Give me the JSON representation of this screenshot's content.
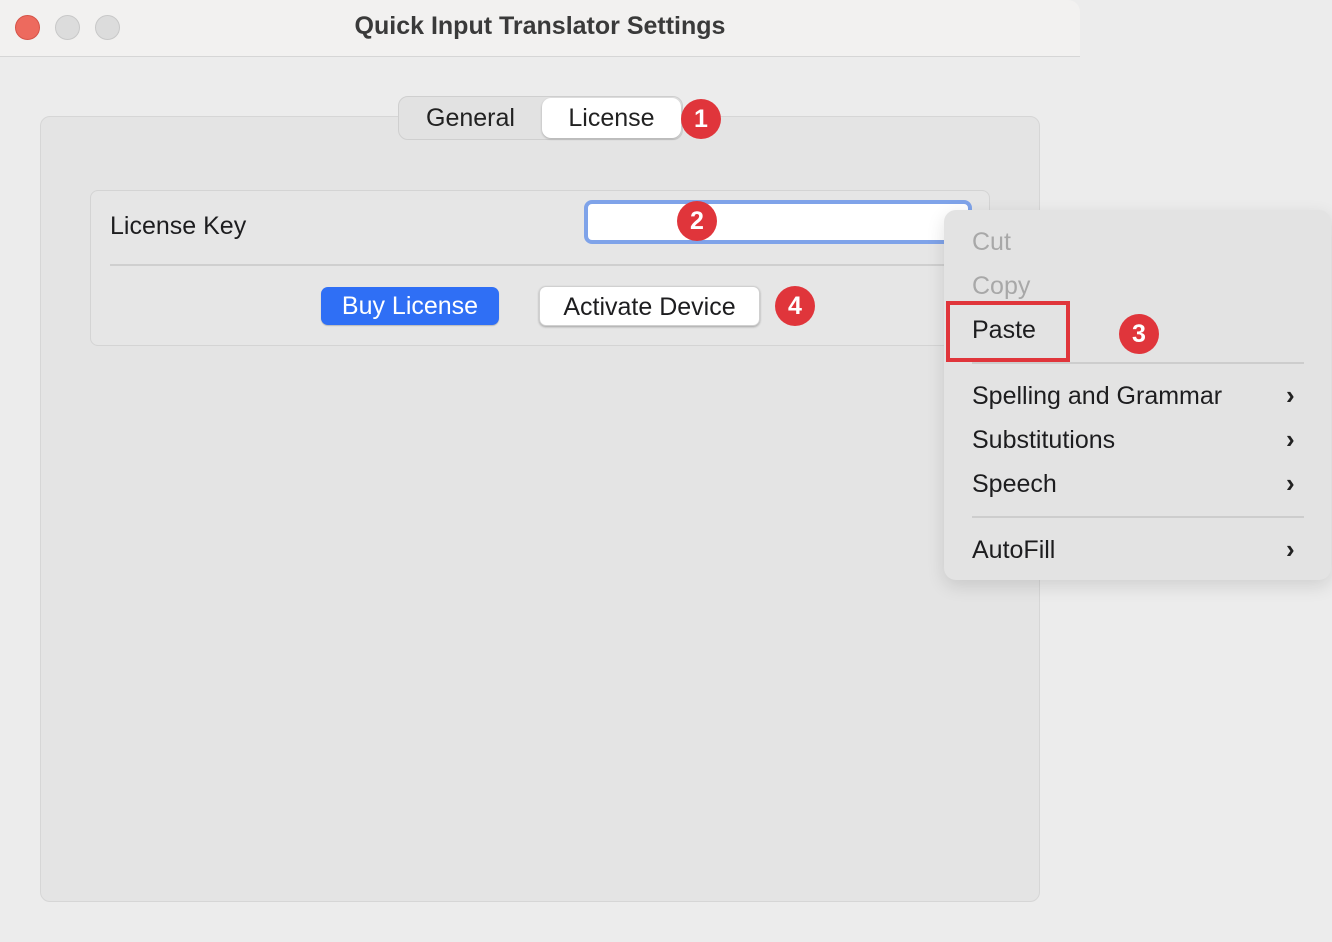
{
  "window": {
    "title": "Quick Input Translator Settings"
  },
  "tabs": [
    {
      "label": "General"
    },
    {
      "label": "License"
    }
  ],
  "license": {
    "key_label": "License Key",
    "key_value": "",
    "buy_label": "Buy License",
    "activate_label": "Activate Device"
  },
  "context_menu": {
    "items": [
      {
        "label": "Cut",
        "disabled": true
      },
      {
        "label": "Copy",
        "disabled": true
      },
      {
        "label": "Paste",
        "disabled": false
      },
      {
        "label": "Spelling and Grammar",
        "submenu": true
      },
      {
        "label": "Substitutions",
        "submenu": true
      },
      {
        "label": "Speech",
        "submenu": true
      },
      {
        "label": "AutoFill",
        "submenu": true
      }
    ]
  },
  "annotations": {
    "badge1": "1",
    "badge2": "2",
    "badge3": "3",
    "badge4": "4"
  },
  "colors": {
    "accent": "#2f6ff5",
    "annotation": "#e0353b",
    "focus_ring": "#7fa3e9"
  },
  "icons": [
    "close-icon",
    "minimize-icon",
    "zoom-icon",
    "chevron-right-icon"
  ]
}
